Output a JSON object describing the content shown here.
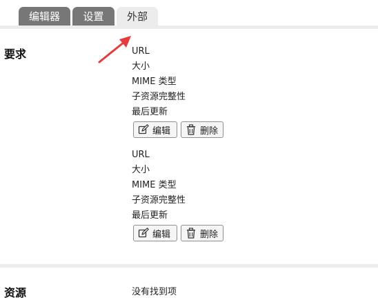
{
  "tabs": [
    {
      "label": "编辑器",
      "active": false
    },
    {
      "label": "设置",
      "active": false
    },
    {
      "label": "外部",
      "active": true
    }
  ],
  "requirements": {
    "label": "要求",
    "items": [
      {
        "fields": [
          "URL",
          "大小",
          "MIME 类型",
          "子资源完整性",
          "最后更新"
        ],
        "edit_label": "编辑",
        "delete_label": "删除"
      },
      {
        "fields": [
          "URL",
          "大小",
          "MIME 类型",
          "子资源完整性",
          "最后更新"
        ],
        "edit_label": "编辑",
        "delete_label": "删除"
      }
    ]
  },
  "resources": {
    "label": "资源",
    "empty_text": "没有找到项"
  },
  "colors": {
    "tab_inactive": "#777777",
    "tab_active": "#ececec",
    "annotation_arrow": "#e8393c"
  },
  "icons": {
    "edit": "pencil-square-icon",
    "delete": "trash-icon",
    "annotation": "red-arrow-icon"
  }
}
